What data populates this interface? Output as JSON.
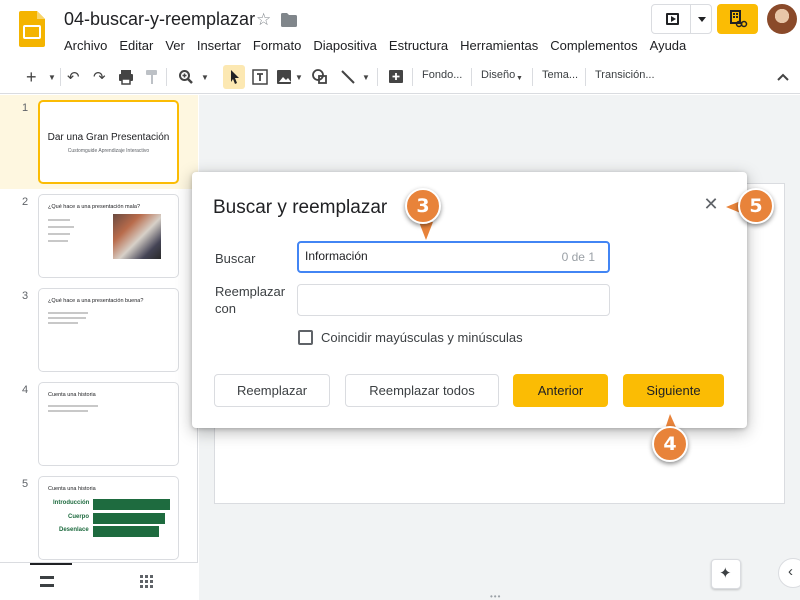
{
  "header": {
    "doc_title": "04-buscar-y-reemplazar",
    "menu": [
      "Archivo",
      "Editar",
      "Ver",
      "Insertar",
      "Formato",
      "Diapositiva",
      "Estructura",
      "Herramientas",
      "Complementos",
      "Ayuda"
    ]
  },
  "toolbar": {
    "background": "Fondo...",
    "layout": "Diseño",
    "theme": "Tema...",
    "transition": "Transición..."
  },
  "slides": [
    {
      "number": "1",
      "title": "Dar una Gran Presentación",
      "subtitle": "Customguide Aprendizaje Interactivo"
    },
    {
      "number": "2",
      "title": "¿Qué hace a una presentación mala?"
    },
    {
      "number": "3",
      "title": "¿Qué hace a una presentación buena?"
    },
    {
      "number": "4",
      "title": "Cuenta una historia"
    },
    {
      "number": "5",
      "title": "Cuenta una historia",
      "labels": [
        "Introducción",
        "Cuerpo",
        "Desenlace"
      ]
    }
  ],
  "dialog": {
    "title": "Buscar y reemplazar",
    "find_label": "Buscar",
    "find_value": "Información",
    "find_count": "0 de 1",
    "replace_label_1": "Reemplazar",
    "replace_label_2": "con",
    "match_case_label": "Coincidir mayúsculas y minúsculas",
    "buttons": {
      "replace": "Reemplazar",
      "replace_all": "Reemplazar todos",
      "previous": "Anterior",
      "next": "Siguiente"
    }
  },
  "callouts": [
    "3",
    "4",
    "5"
  ],
  "colors": {
    "accent": "#fbbc04",
    "callout": "#e8833a",
    "focus": "#4285f4"
  }
}
